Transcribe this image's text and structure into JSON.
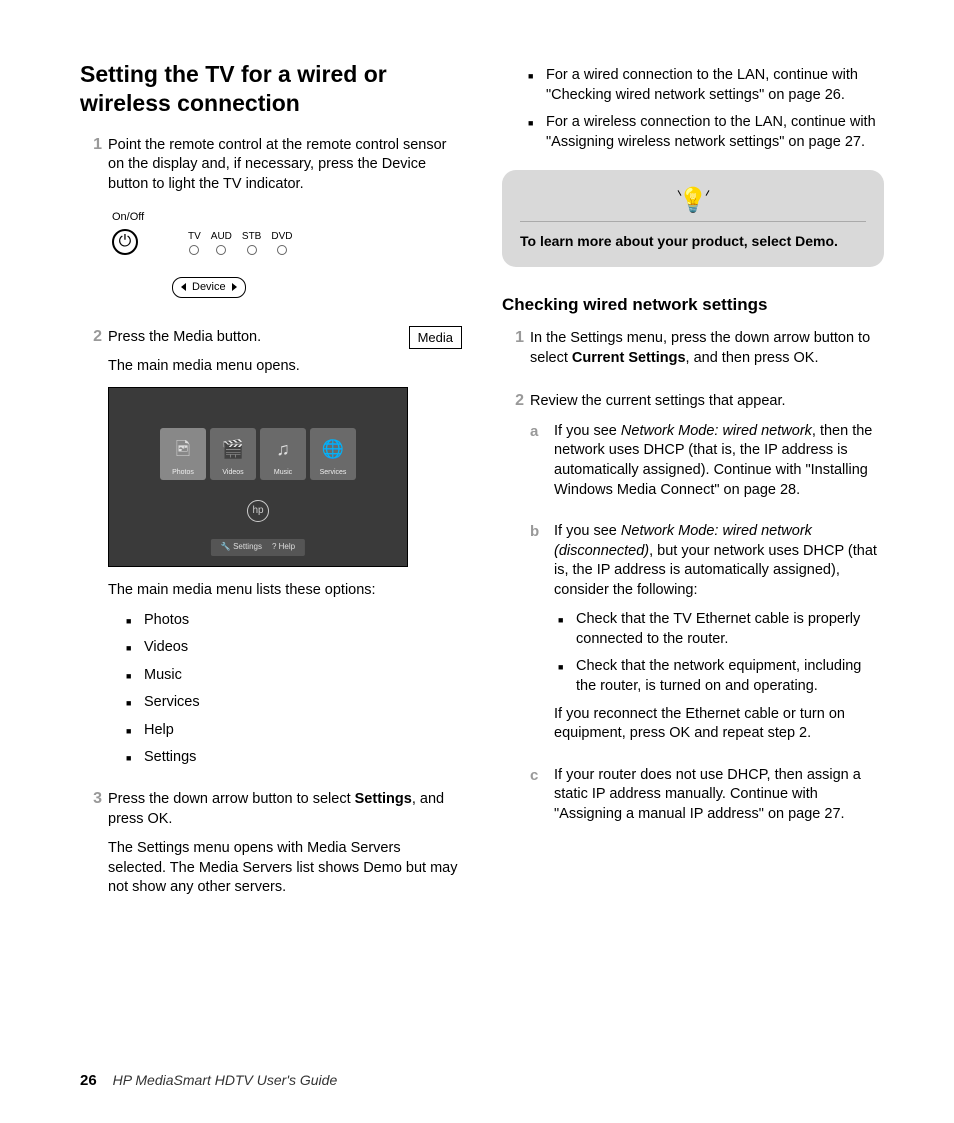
{
  "title": "Setting the TV for a wired or wireless connection",
  "steps": {
    "s1": "Point the remote control at the remote control sensor on the display and, if necessary, press the Device button to light the TV indicator.",
    "s2_a": "Press the Media button.",
    "s2_b": "The main media menu opens.",
    "s2_c": "The main media menu lists these options:",
    "s3_a_pre": "Press the down arrow button to select ",
    "s3_a_bold": "Settings",
    "s3_a_post": ", and press OK.",
    "s3_b": "The Settings menu opens with Media Servers selected. The Media Servers list shows Demo but may not show any other servers."
  },
  "remote": {
    "onoff": "On/Off",
    "sources": [
      "TV",
      "AUD",
      "STB",
      "DVD"
    ],
    "device": "Device",
    "media": "Media"
  },
  "tiles": {
    "photos": "Photos",
    "videos": "Videos",
    "music": "Music",
    "services": "Services"
  },
  "tv_bottom": {
    "settings": "Settings",
    "help": "? Help"
  },
  "media_options": [
    "Photos",
    "Videos",
    "Music",
    "Services",
    "Help",
    "Settings"
  ],
  "right_bullets": {
    "b1": "For a wired connection to the LAN, continue with \"Checking wired network settings\" on page 26.",
    "b2": "For a wireless connection to the LAN, continue with \"Assigning wireless network settings\" on page 27."
  },
  "tip": "To learn more about your product, select Demo.",
  "h2": "Checking wired network settings",
  "c1_pre": "In the Settings menu, press the down arrow button to select ",
  "c1_bold": "Current Settings",
  "c1_post": ", and then press OK.",
  "c2": "Review the current settings that appear.",
  "a": {
    "pre": "If you see ",
    "ital": "Network Mode: wired network",
    "post": ", then the network uses DHCP (that is, the IP address is automatically assigned). Continue with \"Installing Windows Media Connect\" on page 28."
  },
  "b": {
    "pre": "If you see ",
    "ital": "Network Mode: wired network (disconnected)",
    "post": ", but your network uses DHCP (that is, the IP address is automatically assigned), consider the following:",
    "bb1": "Check that the TV Ethernet cable is properly connected to the router.",
    "bb2": "Check that the network equipment, including the router, is turned on and operating.",
    "after": "If you reconnect the Ethernet cable or turn on equipment, press OK and repeat step 2."
  },
  "c": "If your router does not use DHCP, then assign a static IP address manually. Continue with \"Assigning a manual IP address\" on page 27.",
  "footer": {
    "page": "26",
    "title": "HP MediaSmart HDTV User's Guide"
  }
}
